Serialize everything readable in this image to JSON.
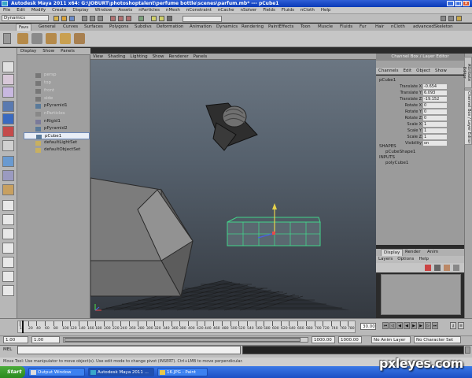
{
  "window": {
    "title": "Autodesk Maya 2011 x64: G:\\JOBURT\\photoshoptalent\\perfume bottle\\scenes\\parfum.mb*  ---  pCube1",
    "buttons": [
      "_",
      "□",
      "✕"
    ]
  },
  "menubar": [
    "File",
    "Edit",
    "Modify",
    "Create",
    "Display",
    "Window",
    "Assets",
    "nParticles",
    "nMesh",
    "nConstraint",
    "nCache",
    "nSolver",
    "Fields",
    "Fluids",
    "nCloth",
    "Help"
  ],
  "status_line": {
    "mode": "Dynamics"
  },
  "shelf_tabs": [
    "Favs",
    "General",
    "Curves",
    "Surfaces",
    "Polygons",
    "Subdivs",
    "Deformation",
    "Animation",
    "Dynamics",
    "Rendering",
    "PaintEffects",
    "Toon",
    "Muscle",
    "Fluids",
    "Fur",
    "Hair",
    "nCloth",
    "advancedSkeleton"
  ],
  "outliner": {
    "menu": [
      "Display",
      "Show",
      "Panels"
    ],
    "items": [
      {
        "label": "persp",
        "state": "dim"
      },
      {
        "label": "top",
        "state": "dim"
      },
      {
        "label": "front",
        "state": "dim"
      },
      {
        "label": "side",
        "state": "dim"
      },
      {
        "label": "pPyramid1",
        "state": "normal"
      },
      {
        "label": "nParticles",
        "state": "dim"
      },
      {
        "label": "nRigid1",
        "state": "normal"
      },
      {
        "label": "pPyramid2",
        "state": "normal"
      },
      {
        "label": "pCube1",
        "state": "selected"
      },
      {
        "label": "defaultLightSet",
        "state": "normal"
      },
      {
        "label": "defaultObjectSet",
        "state": "normal"
      }
    ]
  },
  "viewport": {
    "menu": [
      "View",
      "Shading",
      "Lighting",
      "Show",
      "Renderer",
      "Panels"
    ]
  },
  "channel_box": {
    "title": "Channel Box / Layer Editor",
    "menu": [
      "Channels",
      "Edit",
      "Object",
      "Show"
    ],
    "object": "pCube1",
    "attributes": [
      {
        "name": "Translate X",
        "value": "-0.654"
      },
      {
        "name": "Translate Y",
        "value": "6.093"
      },
      {
        "name": "Translate Z",
        "value": "-19.152"
      },
      {
        "name": "Rotate X",
        "value": "0"
      },
      {
        "name": "Rotate Y",
        "value": "0"
      },
      {
        "name": "Rotate Z",
        "value": "0"
      },
      {
        "name": "Scale X",
        "value": "1"
      },
      {
        "name": "Scale Y",
        "value": "1"
      },
      {
        "name": "Scale Z",
        "value": "1"
      },
      {
        "name": "Visibility",
        "value": "on"
      }
    ],
    "shapes_label": "SHAPES",
    "shape": "pCubeShape1",
    "inputs_label": "INPUTS",
    "input": "polyCube1"
  },
  "side_tabs": [
    "Attribute Editor",
    "Channel Box / Layer Editor"
  ],
  "layer_editor": {
    "tabs": [
      "Display",
      "Render",
      "Anim"
    ],
    "menu": [
      "Layers",
      "Options",
      "Help"
    ]
  },
  "time_slider": {
    "ticks": [
      "1",
      "20",
      "40",
      "60",
      "80",
      "100",
      "120",
      "140",
      "160",
      "180",
      "200",
      "220",
      "240",
      "260",
      "280",
      "300",
      "320",
      "340",
      "360",
      "380",
      "400",
      "420",
      "440",
      "460",
      "480",
      "500",
      "520",
      "540",
      "560",
      "580",
      "600",
      "620",
      "640",
      "660",
      "680",
      "700",
      "720",
      "740",
      "760",
      "780"
    ],
    "current_frame": "30.00"
  },
  "range_slider": {
    "start_time": "1.00",
    "start_range": "1.00",
    "end_range": "1000.00",
    "end_time": "1000.00",
    "anim_layer": "No Anim Layer",
    "character_set": "No Character Set"
  },
  "command_line": {
    "label": "MEL"
  },
  "help_line": "Move Tool: Use manipulator to move object(s). Use edit mode to change pivot (INSERT). Ctrl+LMB to move perpendicular.",
  "taskbar": {
    "start": "Start",
    "buttons": [
      {
        "label": "Output Window",
        "active": false
      },
      {
        "label": "Autodesk Maya 2011 ...",
        "active": true
      },
      {
        "label": "16.JPG - Paint",
        "active": false
      }
    ]
  },
  "watermark": "pxleyes.com"
}
